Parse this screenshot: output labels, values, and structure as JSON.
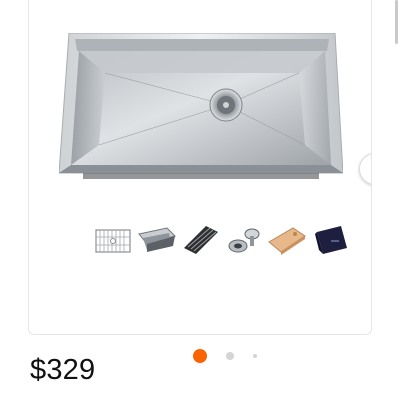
{
  "product": {
    "price": "$329"
  },
  "gallery": {
    "main_image": "stainless-steel-workstation-sink",
    "next_icon": "chevron-right-icon",
    "thumbnails": [
      {
        "icon": "bottom-grid-icon"
      },
      {
        "icon": "colander-icon"
      },
      {
        "icon": "roll-up-rack-icon"
      },
      {
        "icon": "drain-strainer-icon"
      },
      {
        "icon": "cutting-board-icon"
      },
      {
        "icon": "towel-icon"
      }
    ],
    "pager": {
      "total": 3,
      "active": 1
    },
    "colors": {
      "accent": "#f96302",
      "inactive_dot": "#d4d4d4",
      "border": "#e6e6e6"
    }
  }
}
